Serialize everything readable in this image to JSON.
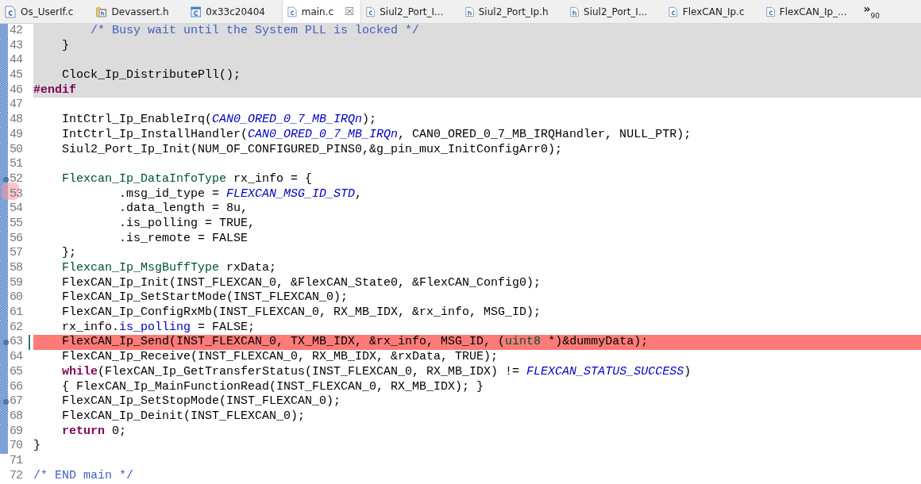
{
  "tabs": [
    {
      "label": "Os_UserIf.c",
      "kind": "c",
      "selected": false
    },
    {
      "label": "Devassert.h",
      "kind": "linked",
      "selected": false
    },
    {
      "label": "0x33c20404",
      "kind": "binary",
      "selected": false
    },
    {
      "label": "main.c",
      "kind": "c",
      "selected": true,
      "close": "☒"
    },
    {
      "label": "Siul2_Port_I...",
      "kind": "c",
      "selected": false
    },
    {
      "label": "Siul2_Port_Ip.h",
      "kind": "h",
      "selected": false
    },
    {
      "label": "Siul2_Port_I...",
      "kind": "h",
      "selected": false
    },
    {
      "label": "FlexCAN_Ip.c",
      "kind": "c",
      "selected": false
    },
    {
      "label": "FlexCAN_Ip_...",
      "kind": "c",
      "selected": false
    }
  ],
  "overflow": {
    "chevron": "»",
    "count": "90"
  },
  "lines": [
    {
      "number": "42",
      "kind": "inactive",
      "changed": true,
      "annotated": false,
      "bookmarked": false,
      "tokens": [
        {
          "kind": "comment",
          "text": "        /* Busy wait until the System PLL is locked */"
        }
      ]
    },
    {
      "number": "43",
      "kind": "inactive",
      "changed": true,
      "annotated": false,
      "bookmarked": false,
      "tokens": [
        {
          "kind": "plain",
          "text": "    }"
        }
      ]
    },
    {
      "number": "44",
      "kind": "inactive",
      "changed": true,
      "annotated": false,
      "bookmarked": false
    },
    {
      "number": "45",
      "kind": "inactive",
      "changed": true,
      "annotated": false,
      "bookmarked": false,
      "tokens": [
        {
          "kind": "plain",
          "text": "    Clock_Ip_DistributePll();"
        }
      ]
    },
    {
      "number": "46",
      "kind": "inactive",
      "changed": true,
      "annotated": false,
      "bookmarked": false,
      "tokens": [
        {
          "kind": "keyword",
          "text": "#endif"
        }
      ]
    },
    {
      "number": "47",
      "kind": "normal",
      "changed": true,
      "annotated": false,
      "bookmarked": false
    },
    {
      "number": "48",
      "kind": "normal",
      "changed": true,
      "annotated": false,
      "bookmarked": false,
      "tokens": [
        {
          "kind": "plain",
          "text": "    IntCtrl_Ip_EnableIrq("
        },
        {
          "kind": "macro",
          "text": "CAN0_ORED_0_7_MB_IRQn"
        },
        {
          "kind": "plain",
          "text": ");"
        }
      ]
    },
    {
      "number": "49",
      "kind": "normal",
      "changed": true,
      "annotated": false,
      "bookmarked": false,
      "tokens": [
        {
          "kind": "plain",
          "text": "    IntCtrl_Ip_InstallHandler("
        },
        {
          "kind": "macro",
          "text": "CAN0_ORED_0_7_MB_IRQn"
        },
        {
          "kind": "plain",
          "text": ", CAN0_ORED_0_7_MB_IRQHandler, NULL_PTR);"
        }
      ]
    },
    {
      "number": "50",
      "kind": "normal",
      "changed": true,
      "annotated": false,
      "bookmarked": false,
      "tokens": [
        {
          "kind": "plain",
          "text": "    Siul2_Port_Ip_Init(NUM_OF_CONFIGURED_PINS0,&g_pin_mux_InitConfigArr0);"
        }
      ]
    },
    {
      "number": "51",
      "kind": "normal",
      "changed": true,
      "annotated": false,
      "bookmarked": false
    },
    {
      "number": "52",
      "kind": "normal",
      "changed": true,
      "annotated": true,
      "bookmarked": false,
      "tokens": [
        {
          "kind": "type",
          "text": "    Flexcan_Ip_DataInfoType"
        },
        {
          "kind": "plain",
          "text": " rx_info = {"
        }
      ]
    },
    {
      "number": "53",
      "kind": "normal",
      "changed": true,
      "annotated": false,
      "bookmarked": true,
      "tokens": [
        {
          "kind": "plain",
          "text": "            .msg_id_type = "
        },
        {
          "kind": "macro",
          "text": "FLEXCAN_MSG_ID_STD"
        },
        {
          "kind": "plain",
          "text": ","
        }
      ]
    },
    {
      "number": "54",
      "kind": "normal",
      "changed": true,
      "annotated": false,
      "bookmarked": false,
      "tokens": [
        {
          "kind": "plain",
          "text": "            .data_length = 8u,"
        }
      ]
    },
    {
      "number": "55",
      "kind": "normal",
      "changed": true,
      "annotated": false,
      "bookmarked": false,
      "tokens": [
        {
          "kind": "plain",
          "text": "            .is_polling = TRUE,"
        }
      ]
    },
    {
      "number": "56",
      "kind": "normal",
      "changed": true,
      "annotated": false,
      "bookmarked": false,
      "tokens": [
        {
          "kind": "plain",
          "text": "            .is_remote = FALSE"
        }
      ]
    },
    {
      "number": "57",
      "kind": "normal",
      "changed": true,
      "annotated": false,
      "bookmarked": false,
      "tokens": [
        {
          "kind": "plain",
          "text": "    };"
        }
      ]
    },
    {
      "number": "58",
      "kind": "normal",
      "changed": true,
      "annotated": false,
      "bookmarked": false,
      "tokens": [
        {
          "kind": "type",
          "text": "    Flexcan_Ip_MsgBuffType"
        },
        {
          "kind": "plain",
          "text": " rxData;"
        }
      ]
    },
    {
      "number": "59",
      "kind": "normal",
      "changed": true,
      "annotated": false,
      "bookmarked": false,
      "tokens": [
        {
          "kind": "plain",
          "text": "    FlexCAN_Ip_Init(INST_FLEXCAN_0, &FlexCAN_State0, &FlexCAN_Config0);"
        }
      ]
    },
    {
      "number": "60",
      "kind": "normal",
      "changed": true,
      "annotated": false,
      "bookmarked": false,
      "tokens": [
        {
          "kind": "plain",
          "text": "    FlexCAN_Ip_SetStartMode(INST_FLEXCAN_0);"
        }
      ]
    },
    {
      "number": "61",
      "kind": "normal",
      "changed": true,
      "annotated": false,
      "bookmarked": false,
      "tokens": [
        {
          "kind": "plain",
          "text": "    FlexCAN_Ip_ConfigRxMb(INST_FLEXCAN_0, RX_MB_IDX, &rx_info, MSG_ID);"
        }
      ]
    },
    {
      "number": "62",
      "kind": "normal",
      "changed": true,
      "annotated": false,
      "bookmarked": false,
      "tokens": [
        {
          "kind": "plain",
          "text": "    rx_info."
        },
        {
          "kind": "field",
          "text": "is_polling"
        },
        {
          "kind": "plain",
          "text": " = FALSE;"
        }
      ]
    },
    {
      "number": "63",
      "kind": "highlighted",
      "changed": true,
      "annotated": true,
      "bookmarked": false,
      "tokens": [
        {
          "kind": "plain",
          "text": "    FlexCAN_Ip_Send(INST_FLEXCAN_0, TX_MB_IDX, &rx_info, MSG_ID, ("
        },
        {
          "kind": "type",
          "text": "uint8"
        },
        {
          "kind": "plain",
          "text": " *)&dummyData);"
        }
      ]
    },
    {
      "number": "64",
      "kind": "normal",
      "changed": true,
      "annotated": false,
      "bookmarked": false,
      "tokens": [
        {
          "kind": "plain",
          "text": "    FlexCAN_Ip_Receive(INST_FLEXCAN_0, RX_MB_IDX, &rxData, TRUE);"
        }
      ]
    },
    {
      "number": "65",
      "kind": "normal",
      "changed": true,
      "annotated": false,
      "bookmarked": false,
      "tokens": [
        {
          "kind": "keyword",
          "text": "    while"
        },
        {
          "kind": "plain",
          "text": "(FlexCAN_Ip_GetTransferStatus(INST_FLEXCAN_0, RX_MB_IDX) != "
        },
        {
          "kind": "macro",
          "text": "FLEXCAN_STATUS_SUCCESS"
        },
        {
          "kind": "plain",
          "text": ")"
        }
      ]
    },
    {
      "number": "66",
      "kind": "normal",
      "changed": true,
      "annotated": false,
      "bookmarked": false,
      "tokens": [
        {
          "kind": "plain",
          "text": "    { FlexCAN_Ip_MainFunctionRead(INST_FLEXCAN_0, RX_MB_IDX); }"
        }
      ]
    },
    {
      "number": "67",
      "kind": "normal",
      "changed": true,
      "annotated": true,
      "bookmarked": false,
      "tokens": [
        {
          "kind": "plain",
          "text": "    FlexCAN_Ip_SetStopMode(INST_FLEXCAN_0);"
        }
      ]
    },
    {
      "number": "68",
      "kind": "normal",
      "changed": true,
      "annotated": false,
      "bookmarked": false,
      "tokens": [
        {
          "kind": "plain",
          "text": "    FlexCAN_Ip_Deinit(INST_FLEXCAN_0);"
        }
      ]
    },
    {
      "number": "69",
      "kind": "normal",
      "changed": true,
      "annotated": false,
      "bookmarked": false,
      "tokens": [
        {
          "kind": "keyword",
          "text": "    return"
        },
        {
          "kind": "plain",
          "text": " 0;"
        }
      ]
    },
    {
      "number": "70",
      "kind": "normal",
      "changed": true,
      "annotated": false,
      "bookmarked": false,
      "tokens": [
        {
          "kind": "plain",
          "text": "}"
        }
      ]
    },
    {
      "number": "71",
      "kind": "normal",
      "changed": false,
      "annotated": false,
      "bookmarked": false
    },
    {
      "number": "72",
      "kind": "normal",
      "changed": false,
      "annotated": false,
      "bookmarked": false,
      "tokens": [
        {
          "kind": "comment",
          "text": "/* END main */"
        }
      ]
    }
  ]
}
